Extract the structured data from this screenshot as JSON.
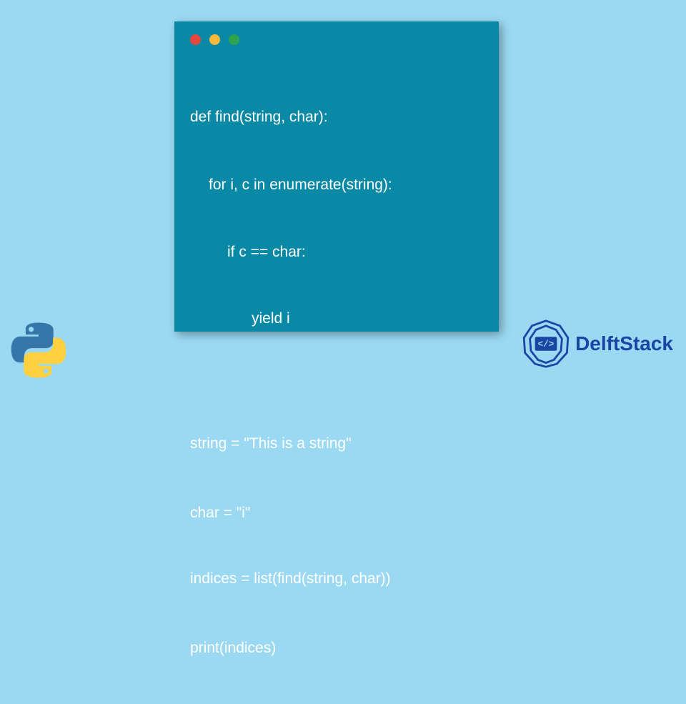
{
  "code": {
    "line1": "def find(string, char):",
    "line2": "for i, c in enumerate(string):",
    "line3": "if c == char:",
    "line4": "yield i",
    "line5": "",
    "line6": "string = \"This is a string\"",
    "line7": "char = \"i\"",
    "line8": "indices = list(find(string, char))",
    "line9": "print(indices)"
  },
  "brand": {
    "name": "DelftStack"
  }
}
